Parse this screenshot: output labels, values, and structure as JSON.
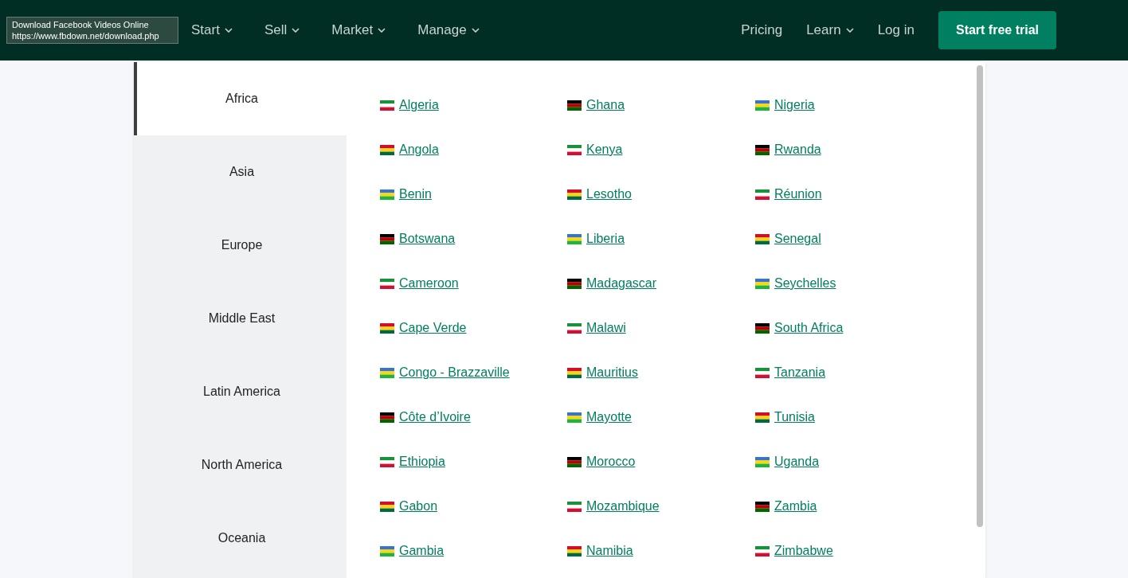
{
  "nav": {
    "menus": [
      {
        "label": "Start",
        "has_menu": true
      },
      {
        "label": "Sell",
        "has_menu": true
      },
      {
        "label": "Market",
        "has_menu": true
      },
      {
        "label": "Manage",
        "has_menu": true
      }
    ],
    "right_links": [
      {
        "label": "Pricing",
        "has_menu": false
      },
      {
        "label": "Learn",
        "has_menu": true
      },
      {
        "label": "Log in",
        "has_menu": false
      }
    ],
    "cta": "Start free trial"
  },
  "tooltip": {
    "title": "Download Facebook Videos Online",
    "url": "https://www.fbdown.net/download.php"
  },
  "regions": [
    {
      "label": "Africa",
      "selected": true
    },
    {
      "label": "Asia",
      "selected": false
    },
    {
      "label": "Europe",
      "selected": false
    },
    {
      "label": "Middle East",
      "selected": false
    },
    {
      "label": "Latin America",
      "selected": false
    },
    {
      "label": "North America",
      "selected": false
    },
    {
      "label": "Oceania",
      "selected": false
    }
  ],
  "countries": [
    "Algeria",
    "Angola",
    "Benin",
    "Botswana",
    "Cameroon",
    "Cape Verde",
    "Congo - Brazzaville",
    "Côte d’Ivoire",
    "Ethiopia",
    "Gabon",
    "Gambia",
    "Ghana",
    "Kenya",
    "Lesotho",
    "Liberia",
    "Madagascar",
    "Malawi",
    "Mauritius",
    "Mayotte",
    "Morocco",
    "Mozambique",
    "Namibia",
    "Nigeria",
    "Rwanda",
    "Réunion",
    "Senegal",
    "Seychelles",
    "South Africa",
    "Tanzania",
    "Tunisia",
    "Uganda",
    "Zambia",
    "Zimbabwe"
  ]
}
